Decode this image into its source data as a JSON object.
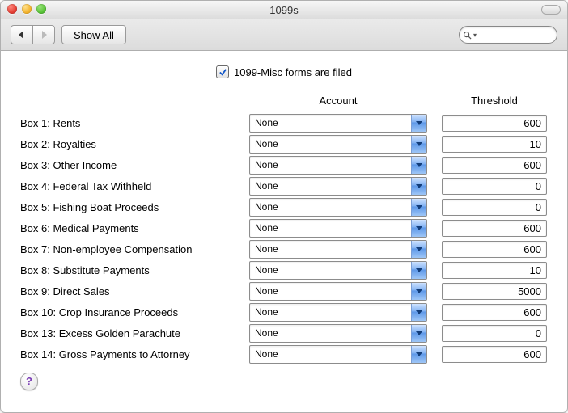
{
  "window": {
    "title": "1099s"
  },
  "toolbar": {
    "show_all_label": "Show All",
    "search_placeholder": ""
  },
  "filed": {
    "checked": true,
    "label": "1099-Misc forms are filed"
  },
  "headers": {
    "account": "Account",
    "threshold": "Threshold"
  },
  "rows": [
    {
      "label": "Box 1:  Rents",
      "account": "None",
      "threshold": "600"
    },
    {
      "label": "Box 2:  Royalties",
      "account": "None",
      "threshold": "10"
    },
    {
      "label": "Box 3:  Other Income",
      "account": "None",
      "threshold": "600"
    },
    {
      "label": "Box 4:  Federal Tax Withheld",
      "account": "None",
      "threshold": "0"
    },
    {
      "label": "Box 5:  Fishing Boat Proceeds",
      "account": "None",
      "threshold": "0"
    },
    {
      "label": "Box 6:  Medical Payments",
      "account": "None",
      "threshold": "600"
    },
    {
      "label": "Box 7:  Non-employee Compensation",
      "account": "None",
      "threshold": "600"
    },
    {
      "label": "Box 8:  Substitute Payments",
      "account": "None",
      "threshold": "10"
    },
    {
      "label": "Box 9:  Direct Sales",
      "account": "None",
      "threshold": "5000"
    },
    {
      "label": "Box 10:  Crop Insurance Proceeds",
      "account": "None",
      "threshold": "600"
    },
    {
      "label": "Box 13:  Excess Golden Parachute",
      "account": "None",
      "threshold": "0"
    },
    {
      "label": "Box 14:  Gross Payments to Attorney",
      "account": "None",
      "threshold": "600"
    }
  ],
  "help_glyph": "?"
}
